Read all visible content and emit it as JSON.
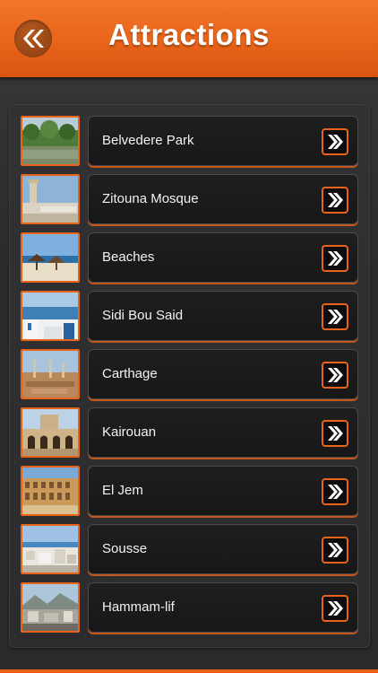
{
  "header": {
    "title": "Attractions",
    "back_icon": "double-chevron-left-icon",
    "accent_color": "#e8641a"
  },
  "list": {
    "items": [
      {
        "label": "Belvedere Park",
        "thumb": "park-photo"
      },
      {
        "label": "Zitouna Mosque",
        "thumb": "mosque-photo"
      },
      {
        "label": "Beaches",
        "thumb": "beach-photo"
      },
      {
        "label": "Sidi Bou Said",
        "thumb": "coastal-village-photo"
      },
      {
        "label": "Carthage",
        "thumb": "ruins-photo"
      },
      {
        "label": "Kairouan",
        "thumb": "great-mosque-photo"
      },
      {
        "label": "El Jem",
        "thumb": "amphitheatre-photo"
      },
      {
        "label": "Sousse",
        "thumb": "city-photo"
      },
      {
        "label": "Hammam-lif",
        "thumb": "town-photo"
      }
    ],
    "go_icon": "double-chevron-right-icon"
  }
}
